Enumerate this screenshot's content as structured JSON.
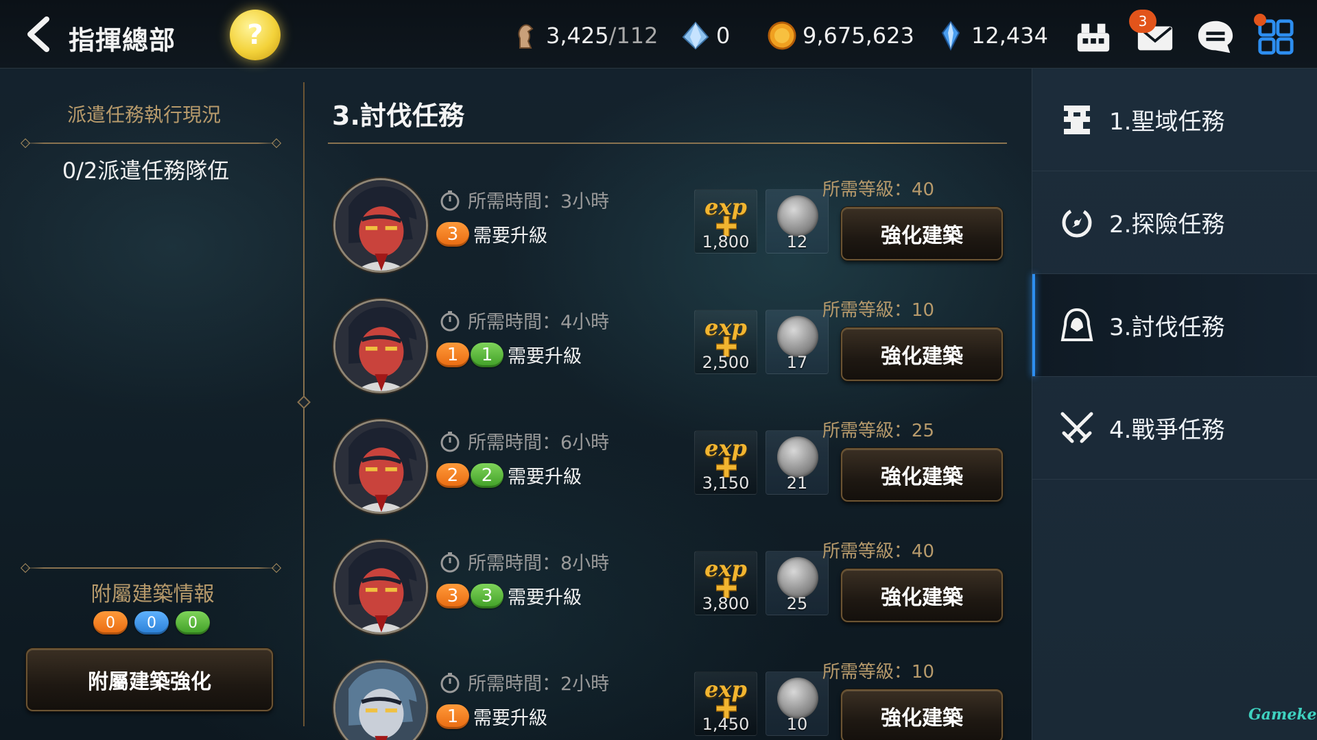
{
  "header": {
    "title": "指揮總部",
    "help_label": "?",
    "resources": {
      "stamina": "3,425",
      "stamina_max": "/112",
      "crystal": "0",
      "gold": "9,675,623",
      "gems": "12,434"
    },
    "mail_badge": "3"
  },
  "left_panel": {
    "dispatch_heading": "派遣任務執行現況",
    "dispatch_team": "0/2派遣任務隊伍",
    "annex_heading": "附屬建築情報",
    "annex_counts": [
      "0",
      "0",
      "0"
    ],
    "annex_button": "附屬建築強化"
  },
  "main": {
    "title": "3.討伐任務",
    "missions": [
      {
        "time_label": "所需時間：",
        "time": "3小時",
        "reqs": [
          "3"
        ],
        "req_colors": [
          "orange"
        ],
        "req_text": "需要升級",
        "exp": "1,800",
        "coin": "12",
        "level": "所需等級：40",
        "button": "強化建築"
      },
      {
        "time_label": "所需時間：",
        "time": "4小時",
        "reqs": [
          "1",
          "1"
        ],
        "req_colors": [
          "orange",
          "green"
        ],
        "req_text": "需要升級",
        "exp": "2,500",
        "coin": "17",
        "level": "所需等級：10",
        "button": "強化建築"
      },
      {
        "time_label": "所需時間：",
        "time": "6小時",
        "reqs": [
          "2",
          "2"
        ],
        "req_colors": [
          "orange",
          "green"
        ],
        "req_text": "需要升級",
        "exp": "3,150",
        "coin": "21",
        "level": "所需等級：25",
        "button": "強化建築"
      },
      {
        "time_label": "所需時間：",
        "time": "8小時",
        "reqs": [
          "3",
          "3"
        ],
        "req_colors": [
          "orange",
          "green"
        ],
        "req_text": "需要升級",
        "exp": "3,800",
        "coin": "25",
        "level": "所需等級：40",
        "button": "強化建築"
      },
      {
        "time_label": "所需時間：",
        "time": "2小時",
        "reqs": [
          "1"
        ],
        "req_colors": [
          "orange"
        ],
        "req_text": "需要升級",
        "exp": "1,450",
        "coin": "10",
        "level": "所需等級：10",
        "button": "強化建築"
      }
    ],
    "exp_word": "exp"
  },
  "tabs": [
    {
      "label": "1.聖域任務",
      "icon": "sanctuary-icon",
      "active": false
    },
    {
      "label": "2.探險任務",
      "icon": "exploration-icon",
      "active": false
    },
    {
      "label": "3.討伐任務",
      "icon": "hooded-figure-icon",
      "active": true
    },
    {
      "label": "4.戰爭任務",
      "icon": "crossed-swords-icon",
      "active": false
    }
  ],
  "watermark": "Gamekee",
  "colors": {
    "accent_blue": "#2d8ef0",
    "gold_text": "#b79a6b",
    "badge_orange": "#e2541b"
  }
}
